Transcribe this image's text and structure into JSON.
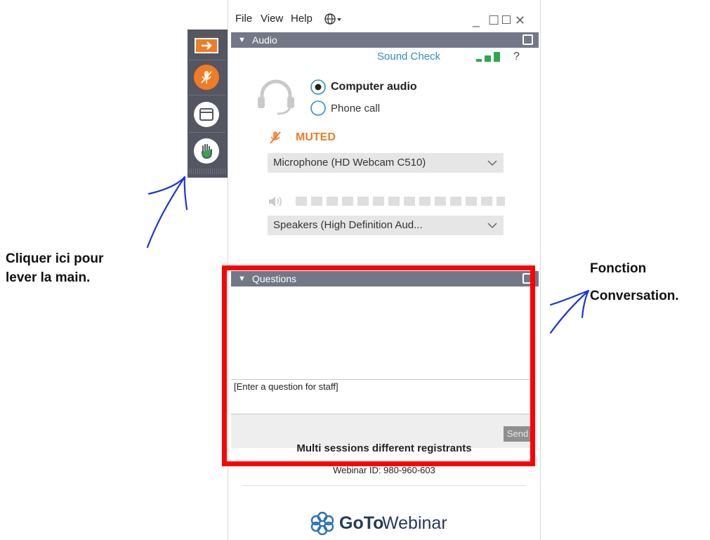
{
  "menu": {
    "file": "File",
    "view": "View",
    "help": "Help",
    "globe_icon": "globe-icon"
  },
  "window_controls": {
    "minimize": "_",
    "restore": "☐",
    "close": "✕"
  },
  "audio": {
    "header": "Audio",
    "sound_check": "Sound Check",
    "help": "?",
    "option_computer": "Computer audio",
    "option_phone": "Phone call",
    "selected_option": "Computer audio",
    "muted_label": "MUTED",
    "microphone": "Microphone (HD Webcam C510)",
    "speakers": "Speakers (High Definition Aud...",
    "accent_color": "#f07c24"
  },
  "questions": {
    "header": "Questions",
    "input_placeholder": "[Enter a question for staff]",
    "send_label": "Send"
  },
  "footer": {
    "session_title": "Multi sessions different registrants",
    "webinar_id": "Webinar ID: 980-960-603",
    "brand_bold": "GoTo",
    "brand_light": "Webinar"
  },
  "annotations": {
    "left_line1": "Cliquer ici pour",
    "left_line2": "lever la main.",
    "right_line1": "Fonction",
    "right_line2": "Conversation.",
    "highlight_color": "#ff0000",
    "arrow_color": "#1a35d9"
  }
}
